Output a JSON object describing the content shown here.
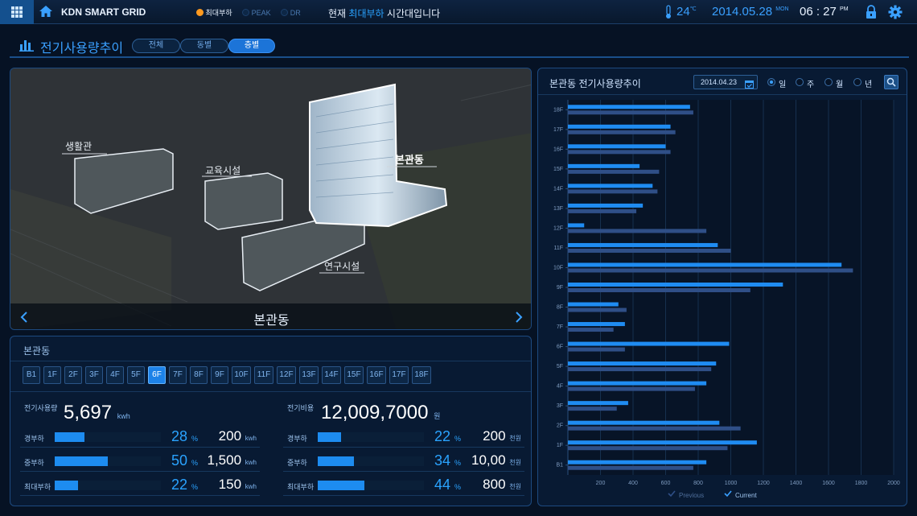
{
  "header": {
    "app_title": "KDN SMART GRID",
    "legend": [
      {
        "label": "최대부하",
        "color": "#ff9a1f"
      },
      {
        "label": "PEAK",
        "color": "#0d2746"
      },
      {
        "label": "DR",
        "color": "#0d2746"
      }
    ],
    "status_prefix": "현재 ",
    "status_highlight": "최대부하",
    "status_suffix": " 시간대입니다",
    "temperature": "24",
    "temp_unit": "℃",
    "date": "2014.05.28",
    "weekday": "MON",
    "time": "06 : 27",
    "ampm": "PM"
  },
  "section": {
    "title": "전기사용량추이",
    "tabs": [
      "전체",
      "동별",
      "층별"
    ],
    "active_tab": 2
  },
  "map": {
    "building_labels": [
      "생활관",
      "교육시설",
      "본관동",
      "연구시설"
    ],
    "current_building": "본관동"
  },
  "floors": {
    "title": "본관동",
    "list": [
      "B1",
      "1F",
      "2F",
      "3F",
      "4F",
      "5F",
      "6F",
      "7F",
      "8F",
      "9F",
      "10F",
      "11F",
      "12F",
      "13F",
      "14F",
      "15F",
      "16F",
      "17F",
      "18F"
    ],
    "active": "6F"
  },
  "usage": {
    "label": "전기사용량",
    "value": "5,697",
    "unit": "kwh",
    "rows": [
      {
        "label": "경부하",
        "pct": 28,
        "pct_text": "28",
        "val": "200",
        "unit": "kwh"
      },
      {
        "label": "중부하",
        "pct": 50,
        "pct_text": "50",
        "val": "1,500",
        "unit": "kwh"
      },
      {
        "label": "최대부하",
        "pct": 22,
        "pct_text": "22",
        "val": "150",
        "unit": "kwh"
      }
    ]
  },
  "cost": {
    "label": "전기비용",
    "value": "12,009,7000",
    "unit": "원",
    "rows": [
      {
        "label": "경부하",
        "pct": 22,
        "pct_text": "22",
        "val": "200",
        "unit": "천원"
      },
      {
        "label": "중부하",
        "pct": 34,
        "pct_text": "34",
        "val": "10,00",
        "unit": "천원"
      },
      {
        "label": "최대부하",
        "pct": 44,
        "pct_text": "44",
        "val": "800",
        "unit": "천원"
      }
    ]
  },
  "pct_unit": "%",
  "right_panel": {
    "title": "본관동 전기사용량추이",
    "date": "2014.04.23",
    "periods": [
      "일",
      "주",
      "월",
      "년"
    ],
    "active_period": 0
  },
  "chart_data": {
    "type": "bar",
    "orientation": "horizontal",
    "categories": [
      "18F",
      "17F",
      "16F",
      "15F",
      "14F",
      "13F",
      "12F",
      "11F",
      "10F",
      "9F",
      "8F",
      "7F",
      "6F",
      "5F",
      "4F",
      "3F",
      "2F",
      "1F",
      "B1"
    ],
    "series": [
      {
        "name": "Current",
        "color": "#1f8cf2",
        "values": [
          750,
          630,
          600,
          440,
          520,
          460,
          100,
          920,
          1680,
          1320,
          310,
          350,
          990,
          910,
          850,
          370,
          930,
          1160,
          850
        ]
      },
      {
        "name": "Previous",
        "color": "#2f4f87",
        "values": [
          770,
          660,
          630,
          560,
          550,
          420,
          850,
          1000,
          1750,
          1120,
          360,
          280,
          350,
          880,
          780,
          300,
          1060,
          980,
          770
        ]
      }
    ],
    "xlim": [
      0,
      2000
    ],
    "xticks": [
      "200",
      "400",
      "600",
      "800",
      "1000",
      "1200",
      "1400",
      "1600",
      "1800",
      "2000"
    ],
    "legend": [
      "Previous",
      "Current"
    ],
    "grid": true
  }
}
